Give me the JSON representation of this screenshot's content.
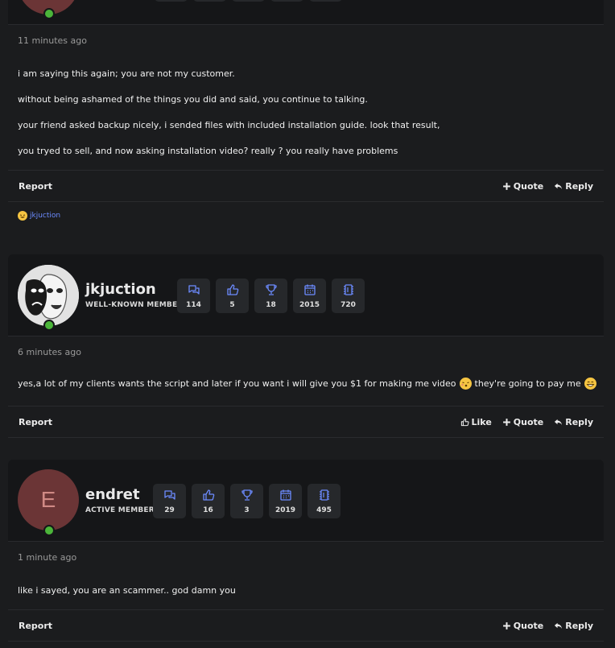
{
  "posts": [
    {
      "time": "11 minutes ago",
      "paragraphs": [
        "i am saying this again; you are not my customer.",
        "without being ashamed of the things you did and said, you continue to talking.",
        "your friend asked backup nicely, i sended files with included installation guide. look that result,",
        "you tryed to sell, and now asking installation video? really ? you really have problems"
      ],
      "actions": {
        "report": "Report",
        "quote": "Quote",
        "reply": "Reply"
      },
      "reaction": {
        "icon": "laughing-emoji-icon",
        "user": "jkjuction"
      }
    },
    {
      "user": {
        "name": "jkjuction",
        "title": "WELL-KNOWN MEMBER",
        "avatar": "masks-avatar"
      },
      "stats": [
        "114",
        "5",
        "18",
        "2015",
        "720"
      ],
      "time": "6 minutes ago",
      "text_a": "yes,a lot of my clients wants the script and later if you want i will give you $1 for making me video",
      "text_b": "they're going to pay me",
      "actions": {
        "report": "Report",
        "like": "Like",
        "quote": "Quote",
        "reply": "Reply"
      }
    },
    {
      "user": {
        "name": "endret",
        "title": "ACTIVE MEMBER",
        "initial": "E",
        "avatar_color": "#6b3536"
      },
      "stats": [
        "29",
        "16",
        "3",
        "2019",
        "495"
      ],
      "time": "1 minute ago",
      "text": "like i sayed, you are an scammer.. god damn you",
      "actions": {
        "report": "Report",
        "quote": "Quote",
        "reply": "Reply"
      }
    }
  ],
  "stat_icons": [
    "messages-icon",
    "likes-icon",
    "trophy-icon",
    "calendar-icon",
    "memory-icon"
  ],
  "colors": {
    "accent": "#6c8bff",
    "online": "#4bb53a",
    "background": "#1b1c1e",
    "header": "#151618"
  }
}
